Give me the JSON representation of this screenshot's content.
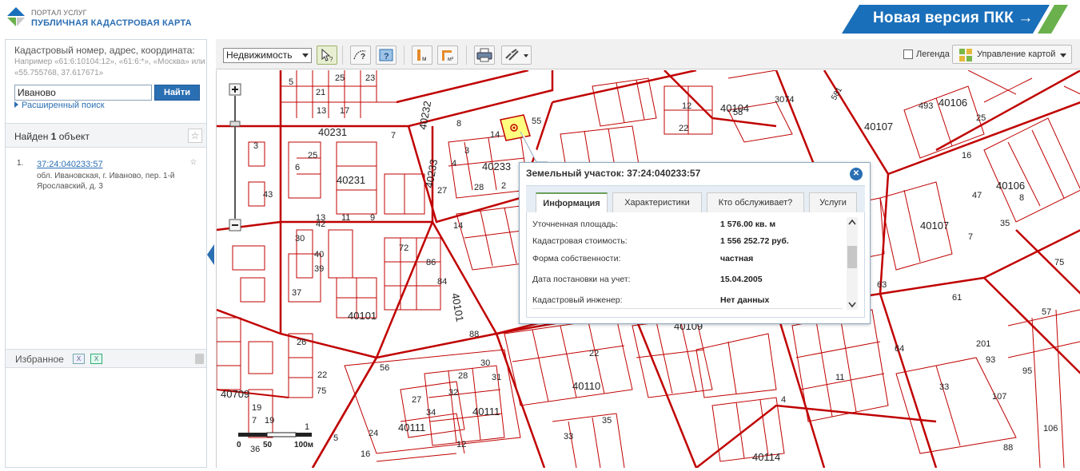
{
  "header": {
    "logo_line1": "ПОРТАЛ УСЛУГ",
    "logo_line2": "ПУБЛИЧНАЯ КАДАСТРОВАЯ КАРТА",
    "new_version_label": "Новая версия ПКК →",
    "brand_blue": "#1a6fba",
    "brand_green": "#6ab04c"
  },
  "search": {
    "title": "Кадастровый номер, адрес, координата:",
    "example": "Например «61:6:10104:12», «61:6:*», «Москва» или «55.755768, 37.617671»",
    "value": "Иваново",
    "button_label": "Найти",
    "advanced_label": "Расширенный поиск"
  },
  "results": {
    "found_prefix": "Найден",
    "found_count": "1",
    "found_suffix": "объект",
    "items": [
      {
        "num": "1.",
        "cadastral": "37:24:040233:57",
        "address": "обл. Ивановская, г. Иваново, пер. 1-й Ярославский, д. 3"
      }
    ]
  },
  "favorites": {
    "label": "Избранное"
  },
  "toolbar": {
    "layer_select": "Недвижимость",
    "legend_label": "Легенда",
    "map_control_label": "Управление картой"
  },
  "popup": {
    "title": "Земельный участок: 37:24:040233:57",
    "tabs": [
      "Информация",
      "Характеристики",
      "Кто обслуживает?",
      "Услуги"
    ],
    "properties": [
      {
        "label": "Уточненная площадь:",
        "value": "1 576.00 кв. м"
      },
      {
        "label": "Кадастровая стоимость:",
        "value": "1 556 252.72 руб."
      },
      {
        "label": "Форма собственности:",
        "value": "частная"
      },
      {
        "label": "Дата постановки на учет:",
        "value": "15.04.2005"
      },
      {
        "label": "Кадастровый инженер:",
        "value": "Нет данных"
      }
    ]
  },
  "map": {
    "parcel_color": "#c00000",
    "highlight_color": "#ffff80",
    "quarter_labels": [
      "40231",
      "40231",
      "40232",
      "40233",
      "40233",
      "40104",
      "40106",
      "40106",
      "40107",
      "40107",
      "40101",
      "40101",
      "40109",
      "40110",
      "40111",
      "40111",
      "40114",
      "40709"
    ],
    "parcel_labels": [
      "25",
      "23",
      "21",
      "17",
      "13",
      "7",
      "5",
      "3",
      "6",
      "8",
      "4",
      "14",
      "55",
      "3",
      "27",
      "28",
      "2",
      "14",
      "13",
      "11",
      "9",
      "25",
      "37",
      "30",
      "40",
      "39",
      "43",
      "42",
      "72",
      "86",
      "84",
      "88",
      "56",
      "26",
      "22",
      "75",
      "36",
      "7",
      "19",
      "19",
      "1",
      "5",
      "24",
      "16",
      "12",
      "34",
      "32",
      "28",
      "30",
      "31",
      "27",
      "22",
      "33",
      "35",
      "64",
      "61",
      "63",
      "11",
      "4",
      "33",
      "107",
      "106",
      "88",
      "57",
      "75",
      "493",
      "25",
      "16",
      "47",
      "35",
      "8",
      "3074",
      "581",
      "58",
      "22",
      "12",
      "93",
      "95",
      "201",
      "7"
    ],
    "scale": {
      "labels": [
        "0",
        "50",
        "100м"
      ]
    }
  }
}
